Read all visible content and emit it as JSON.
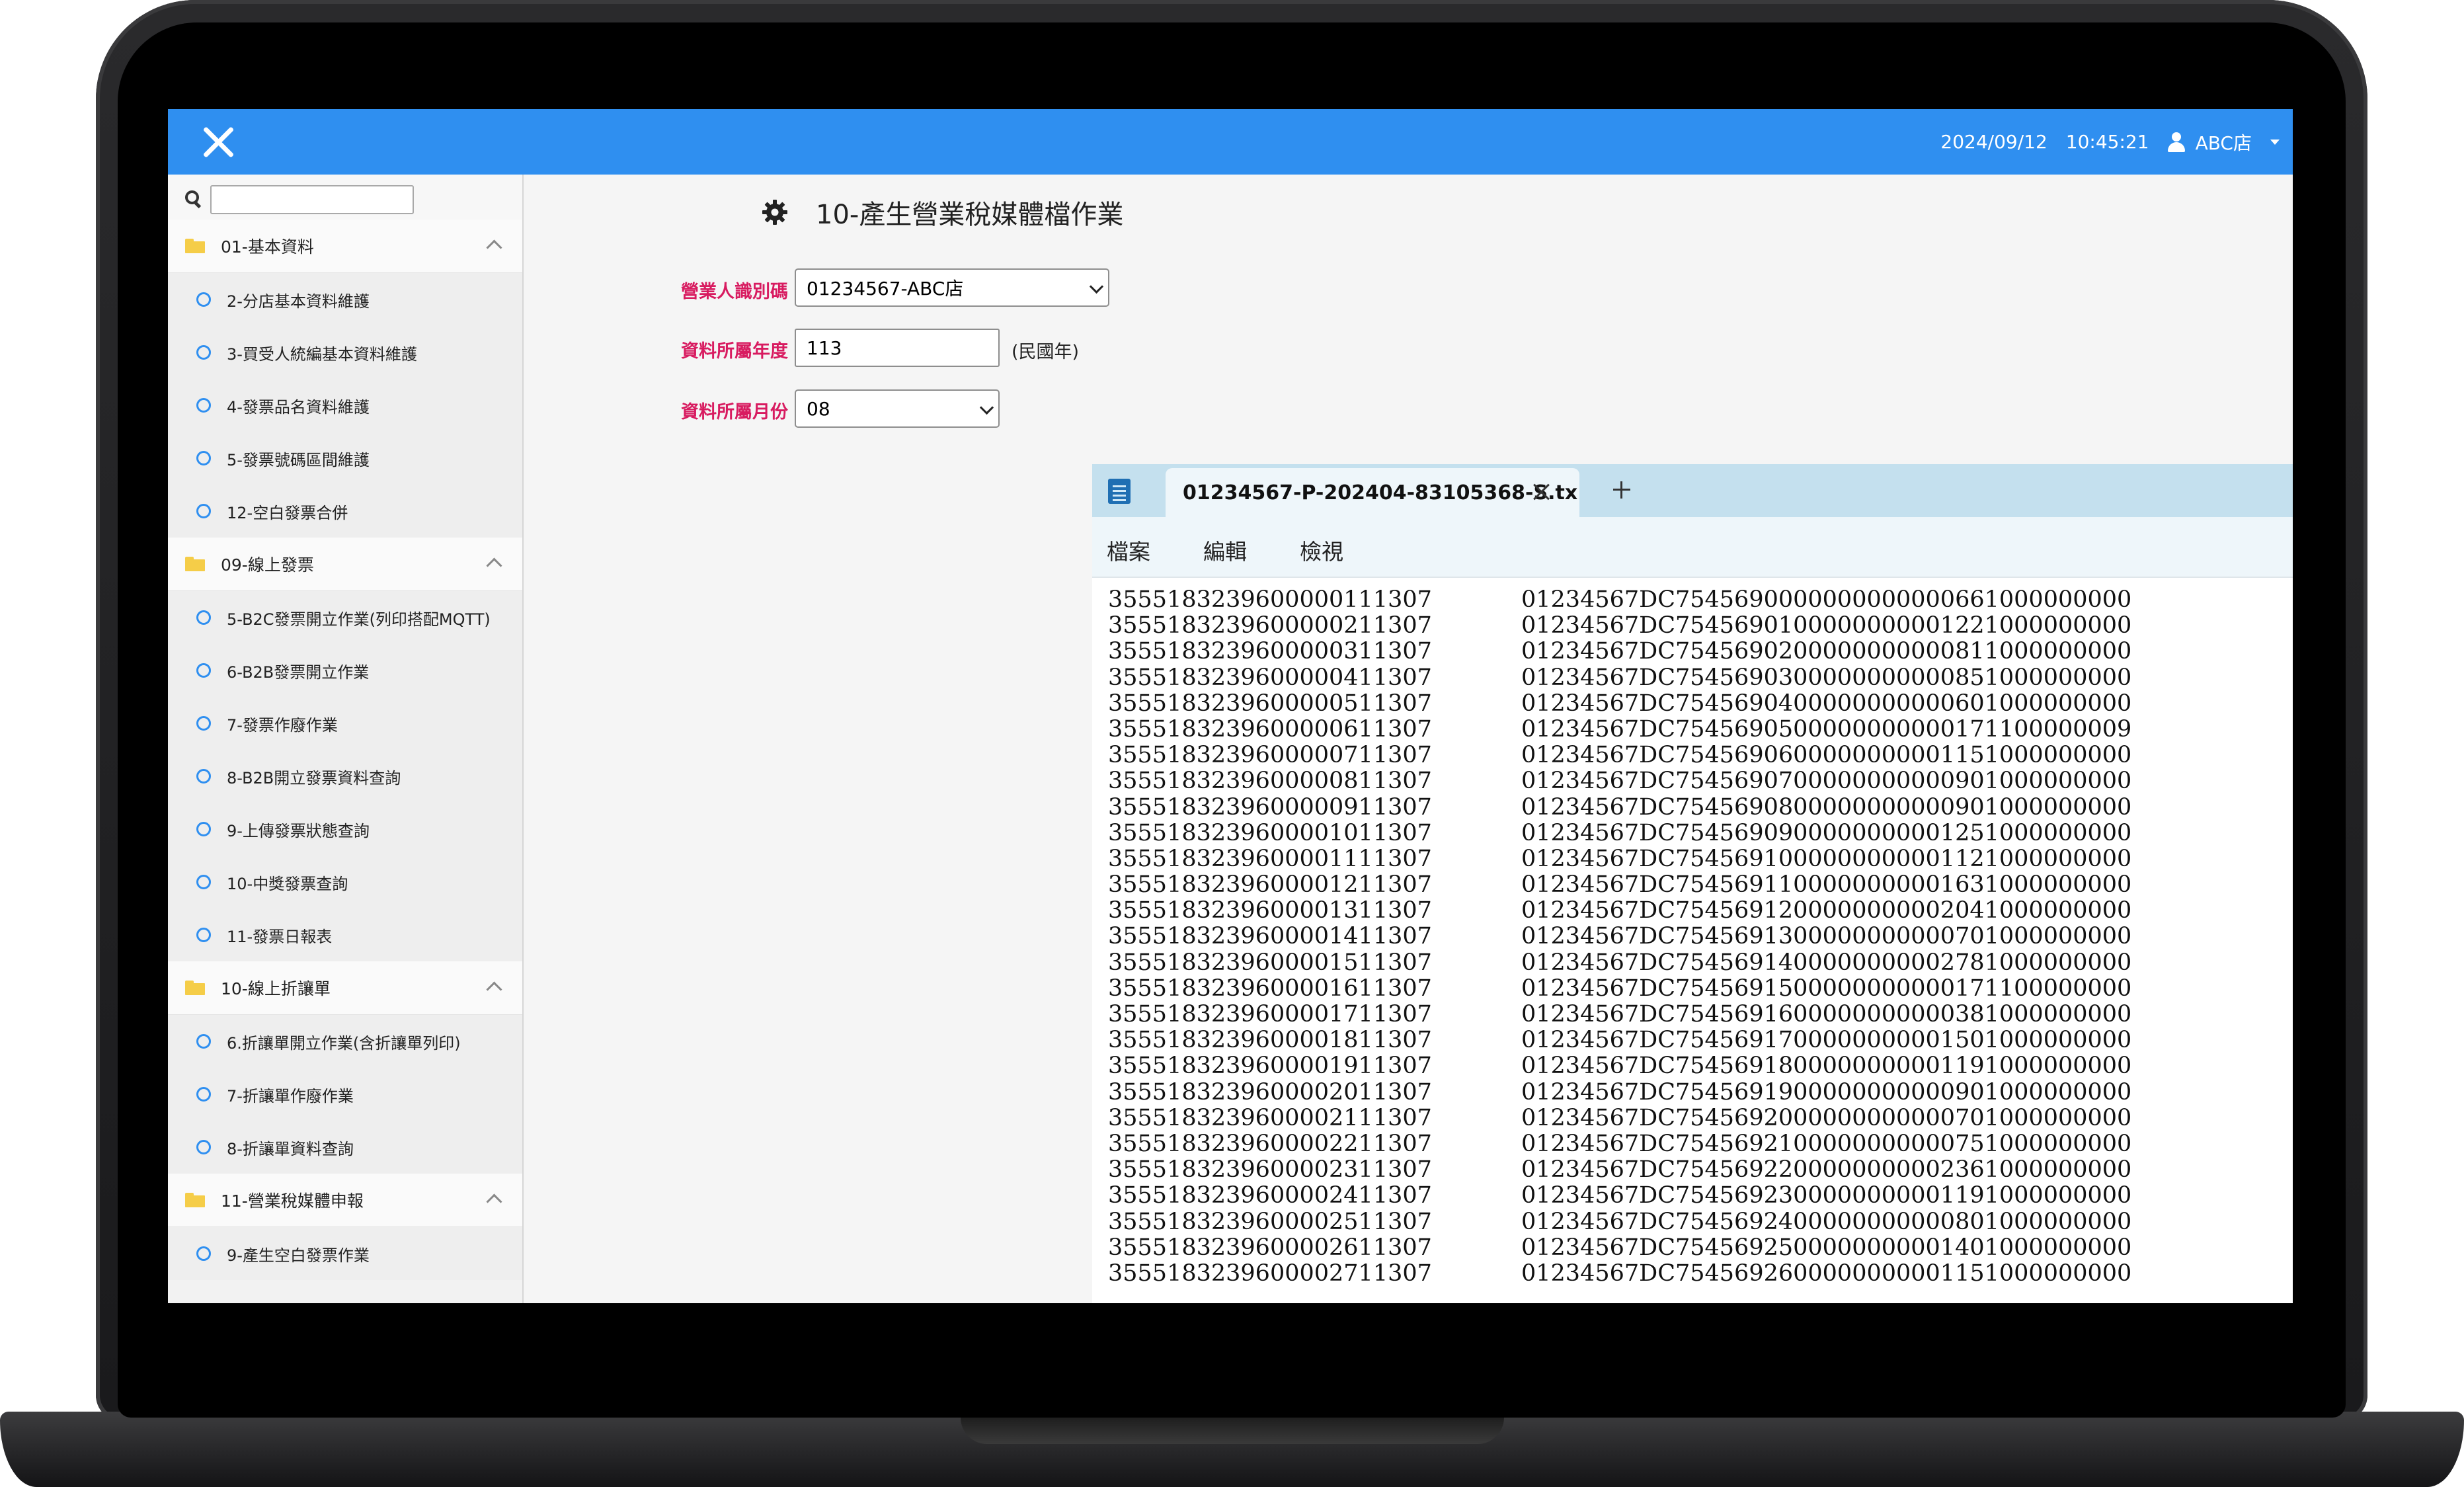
{
  "topbar": {
    "date": "2024/09/12",
    "time": "10:45:21",
    "user": "ABC店"
  },
  "sidebar": {
    "search_placeholder": "",
    "groups": [
      {
        "label": "01-基本資料",
        "items": [
          "2-分店基本資料維護",
          "3-買受人統編基本資料維護",
          "4-發票品名資料維護",
          "5-發票號碼區間維護",
          "12-空白發票合併"
        ]
      },
      {
        "label": "09-線上發票",
        "items": [
          "5-B2C發票開立作業(列印搭配MQTT)",
          "6-B2B發票開立作業",
          "7-發票作廢作業",
          "8-B2B開立發票資料查詢",
          "9-上傳發票狀態查詢",
          "10-中獎發票查詢",
          "11-發票日報表"
        ]
      },
      {
        "label": "10-線上折讓單",
        "items": [
          "6.折讓單開立作業(含折讓單列印)",
          "7-折讓單作廢作業",
          "8-折讓單資料查詢"
        ]
      },
      {
        "label": "11-營業稅媒體申報",
        "items": [
          "9-產生空白發票作業"
        ]
      }
    ]
  },
  "main": {
    "title": "10-產生營業稅媒體檔作業",
    "form": {
      "business_id_label": "營業人識別碼",
      "business_id_value": "01234567-ABC店",
      "year_label": "資料所屬年度",
      "year_value": "113",
      "year_suffix": "(民國年)",
      "month_label": "資料所屬月份",
      "month_value": "08"
    }
  },
  "notepad": {
    "tab_title": "01234567-P-202404-83105368-S.tx",
    "menu": [
      "檔案",
      "編輯",
      "檢視"
    ],
    "lines": [
      [
        "3555183239600000111307",
        "01234567DC7545690000000000000661000000000"
      ],
      [
        "3555183239600000211307",
        "01234567DC7545690100000000001221000000000"
      ],
      [
        "3555183239600000311307",
        "01234567DC7545690200000000000811000000000"
      ],
      [
        "3555183239600000411307",
        "01234567DC7545690300000000000851000000000"
      ],
      [
        "3555183239600000511307",
        "01234567DC7545690400000000000601000000000"
      ],
      [
        "3555183239600000611307",
        "01234567DC7545690500000000000171100000009"
      ],
      [
        "3555183239600000711307",
        "01234567DC7545690600000000001151000000000"
      ],
      [
        "3555183239600000811307",
        "01234567DC7545690700000000000901000000000"
      ],
      [
        "3555183239600000911307",
        "01234567DC7545690800000000000901000000000"
      ],
      [
        "3555183239600001011307",
        "01234567DC7545690900000000001251000000000"
      ],
      [
        "3555183239600001111307",
        "01234567DC7545691000000000001121000000000"
      ],
      [
        "3555183239600001211307",
        "01234567DC7545691100000000001631000000000"
      ],
      [
        "3555183239600001311307",
        "01234567DC7545691200000000002041000000000"
      ],
      [
        "3555183239600001411307",
        "01234567DC7545691300000000000701000000000"
      ],
      [
        "3555183239600001511307",
        "01234567DC7545691400000000002781000000000"
      ],
      [
        "3555183239600001611307",
        "01234567DC7545691500000000000171100000000"
      ],
      [
        "3555183239600001711307",
        "01234567DC7545691600000000000381000000000"
      ],
      [
        "3555183239600001811307",
        "01234567DC7545691700000000001501000000000"
      ],
      [
        "3555183239600001911307",
        "01234567DC7545691800000000001191000000000"
      ],
      [
        "3555183239600002011307",
        "01234567DC7545691900000000000901000000000"
      ],
      [
        "3555183239600002111307",
        "01234567DC7545692000000000000701000000000"
      ],
      [
        "3555183239600002211307",
        "01234567DC7545692100000000000751000000000"
      ],
      [
        "3555183239600002311307",
        "01234567DC7545692200000000002361000000000"
      ],
      [
        "3555183239600002411307",
        "01234567DC7545692300000000001191000000000"
      ],
      [
        "3555183239600002511307",
        "01234567DC7545692400000000000801000000000"
      ],
      [
        "3555183239600002611307",
        "01234567DC7545692500000000001401000000000"
      ],
      [
        "3555183239600002711307",
        "01234567DC7545692600000000001151000000000"
      ]
    ]
  },
  "colors": {
    "topbar": "#2f8ff0",
    "label_accent": "#d81b60",
    "notepad_tabbar": "#c4e0ee"
  },
  "icons": [
    "close-icon",
    "user-icon",
    "caret-down-icon",
    "search-icon",
    "folder-icon",
    "chevron-up-icon",
    "circle-icon",
    "gear-icon",
    "notepad-icon",
    "tab-close-icon",
    "tab-add-icon"
  ]
}
